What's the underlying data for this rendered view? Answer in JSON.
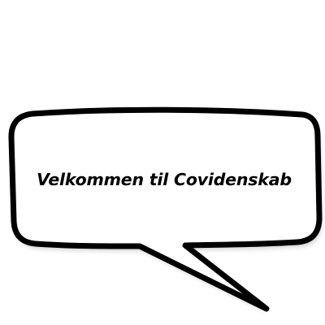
{
  "speech_bubble": {
    "message": "Velkommen til Covidenskab",
    "outline_color": "#000000",
    "fill_color": "#ffffff",
    "shadow_color": "#cfcfcf"
  }
}
